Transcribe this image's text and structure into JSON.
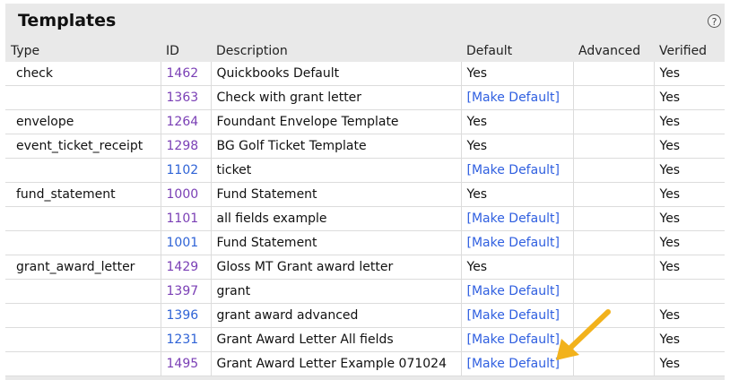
{
  "panel": {
    "title": "Templates",
    "help_icon": "?"
  },
  "table": {
    "headers": [
      "Type",
      "ID",
      "Description",
      "Default",
      "Advanced",
      "Verified"
    ],
    "make_default_label": "[Make Default]",
    "rows": [
      {
        "type": "check",
        "id": "1462",
        "description": "Quickbooks Default",
        "default": "Yes",
        "advanced": "",
        "verified": "Yes"
      },
      {
        "type": "",
        "id": "1363",
        "description": "Check with grant letter",
        "default": "[Make Default]",
        "advanced": "",
        "verified": "Yes"
      },
      {
        "type": "envelope",
        "id": "1264",
        "description": "Foundant Envelope Template",
        "default": "Yes",
        "advanced": "",
        "verified": "Yes"
      },
      {
        "type": "event_ticket_receipt",
        "id": "1298",
        "description": "BG Golf Ticket Template",
        "default": "Yes",
        "advanced": "",
        "verified": "Yes"
      },
      {
        "type": "",
        "id": "1102",
        "description": "ticket",
        "default": "[Make Default]",
        "advanced": "",
        "verified": "Yes"
      },
      {
        "type": "fund_statement",
        "id": "1000",
        "description": "Fund Statement",
        "default": "Yes",
        "advanced": "",
        "verified": "Yes"
      },
      {
        "type": "",
        "id": "1101",
        "description": "all fields example",
        "default": "[Make Default]",
        "advanced": "",
        "verified": "Yes"
      },
      {
        "type": "",
        "id": "1001",
        "description": "Fund Statement",
        "default": "[Make Default]",
        "advanced": "",
        "verified": "Yes"
      },
      {
        "type": "grant_award_letter",
        "id": "1429",
        "description": "Gloss MT Grant award letter",
        "default": "Yes",
        "advanced": "",
        "verified": "Yes"
      },
      {
        "type": "",
        "id": "1397",
        "description": "grant",
        "default": "[Make Default]",
        "advanced": "",
        "verified": ""
      },
      {
        "type": "",
        "id": "1396",
        "description": "grant award advanced",
        "default": "[Make Default]",
        "advanced": "",
        "verified": "Yes"
      },
      {
        "type": "",
        "id": "1231",
        "description": "Grant Award Letter All fields",
        "default": "[Make Default]",
        "advanced": "",
        "verified": "Yes"
      },
      {
        "type": "",
        "id": "1495",
        "description": "Grant Award Letter Example 071024",
        "default": "[Make Default]",
        "advanced": "",
        "verified": "Yes"
      }
    ]
  },
  "colors": {
    "visited_id": "#7a3fb5",
    "link": "#2f5fe0",
    "arrow": "#f2b21c"
  },
  "annotation": {
    "arrow_icon": "pointer-arrow-icon"
  }
}
